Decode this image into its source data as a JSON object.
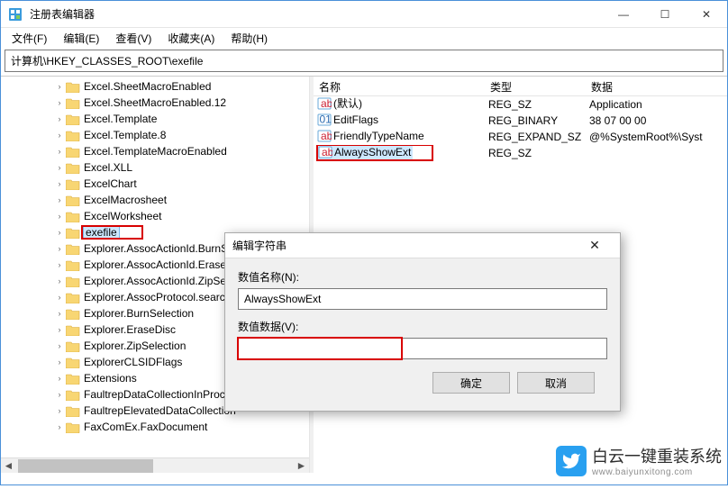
{
  "window": {
    "title": "注册表编辑器",
    "min": "—",
    "max": "☐",
    "close": "✕"
  },
  "menu": {
    "file": "文件(F)",
    "edit": "编辑(E)",
    "view": "查看(V)",
    "fav": "收藏夹(A)",
    "help": "帮助(H)"
  },
  "address": "计算机\\HKEY_CLASSES_ROOT\\exefile",
  "tree": [
    {
      "label": "Excel.SheetMacroEnabled",
      "depth": 3
    },
    {
      "label": "Excel.SheetMacroEnabled.12",
      "depth": 3
    },
    {
      "label": "Excel.Template",
      "depth": 3
    },
    {
      "label": "Excel.Template.8",
      "depth": 3
    },
    {
      "label": "Excel.TemplateMacroEnabled",
      "depth": 3
    },
    {
      "label": "Excel.XLL",
      "depth": 3
    },
    {
      "label": "ExcelChart",
      "depth": 3
    },
    {
      "label": "ExcelMacrosheet",
      "depth": 3
    },
    {
      "label": "ExcelWorksheet",
      "depth": 3
    },
    {
      "label": "exefile",
      "depth": 3,
      "selected": true,
      "hilite": true
    },
    {
      "label": "Explorer.AssocActionId.BurnSelection",
      "depth": 3,
      "trunc": "Explorer.AssocActionId.BurnS"
    },
    {
      "label": "Explorer.AssocActionId.EraseDisc",
      "depth": 3,
      "trunc": "Explorer.AssocActionId.EraseI"
    },
    {
      "label": "Explorer.AssocActionId.ZipSelection",
      "depth": 3,
      "trunc": "Explorer.AssocActionId.ZipSel"
    },
    {
      "label": "Explorer.AssocProtocol.search-ms",
      "depth": 3,
      "trunc": "Explorer.AssocProtocol.searcl"
    },
    {
      "label": "Explorer.BurnSelection",
      "depth": 3
    },
    {
      "label": "Explorer.EraseDisc",
      "depth": 3
    },
    {
      "label": "Explorer.ZipSelection",
      "depth": 3
    },
    {
      "label": "ExplorerCLSIDFlags",
      "depth": 3
    },
    {
      "label": "Extensions",
      "depth": 3
    },
    {
      "label": "FaultrepDataCollectionInProc",
      "depth": 3
    },
    {
      "label": "FaultrepElevatedDataCollection",
      "depth": 3
    },
    {
      "label": "FaxComEx.FaxDocument",
      "depth": 3
    }
  ],
  "list": {
    "cols": {
      "name": "名称",
      "type": "类型",
      "data": "数据"
    },
    "rows": [
      {
        "icon": "str",
        "name": "(默认)",
        "type": "REG_SZ",
        "data": "Application"
      },
      {
        "icon": "bin",
        "name": "EditFlags",
        "type": "REG_BINARY",
        "data": "38 07 00 00"
      },
      {
        "icon": "str",
        "name": "FriendlyTypeName",
        "type": "REG_EXPAND_SZ",
        "data": "@%SystemRoot%\\Syst"
      },
      {
        "icon": "str",
        "name": "AlwaysShowExt",
        "type": "REG_SZ",
        "data": "",
        "selected": true,
        "hilite": true
      }
    ]
  },
  "dialog": {
    "title": "编辑字符串",
    "name_label": "数值名称(N):",
    "name_value": "AlwaysShowExt",
    "data_label": "数值数据(V):",
    "data_value": "",
    "ok": "确定",
    "cancel": "取消"
  },
  "watermark": {
    "line1": "白云一键重装系统",
    "line2": "www.baiyunxitong.com"
  }
}
